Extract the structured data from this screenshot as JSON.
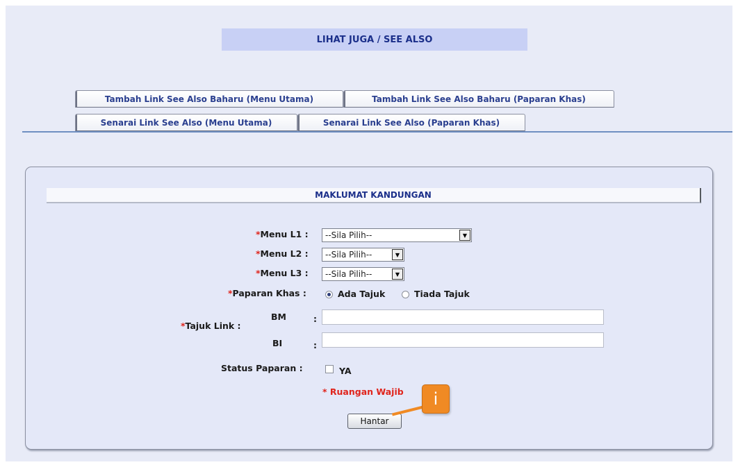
{
  "header": {
    "title": "LIHAT JUGA / SEE ALSO"
  },
  "tabs": [
    {
      "label": "Tambah Link See Also Baharu (Menu Utama)"
    },
    {
      "label": "Tambah Link See Also Baharu (Paparan Khas)"
    },
    {
      "label": "Senarai Link See Also (Menu Utama)"
    },
    {
      "label": "Senarai Link See Also (Paparan Khas)"
    }
  ],
  "form": {
    "section_title": "MAKLUMAT KANDUNGAN",
    "required_mark": "*",
    "menu_l1": {
      "label": "Menu L1 :",
      "value": "--Sila Pilih--"
    },
    "menu_l2": {
      "label": "Menu L2 :",
      "value": "--Sila Pilih--"
    },
    "menu_l3": {
      "label": "Menu L3 :",
      "value": "--Sila Pilih--"
    },
    "paparan_khas": {
      "label": "Paparan Khas :",
      "options": [
        "Ada Tajuk",
        "Tiada Tajuk"
      ],
      "selected": "Ada Tajuk"
    },
    "tajuk_link": {
      "label": "Tajuk Link :",
      "bm_label": "BM",
      "bi_label": "BI",
      "separator": ":",
      "bm_value": "",
      "bi_value": ""
    },
    "status_paparan": {
      "label": "Status Paparan :",
      "option": "YA",
      "checked": false
    },
    "required_note": "* Ruangan Wajib",
    "submit_label": "Hantar"
  },
  "annotation": {
    "icon": "info-icon",
    "glyph": "i"
  },
  "colors": {
    "accent": "#1b2f8a",
    "required": "#e0241c",
    "badge": "#f08a24",
    "background": "#e8ebf7"
  }
}
